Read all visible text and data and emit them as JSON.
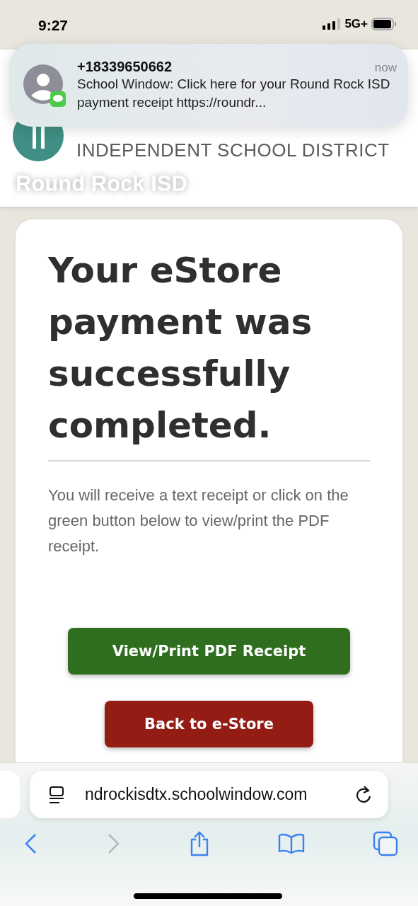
{
  "status_bar": {
    "time": "9:27",
    "network": "5G+"
  },
  "notification": {
    "sender": "+18339650662",
    "time": "now",
    "message": "School Window: Click here for your Round Rock ISD payment receipt https://roundr..."
  },
  "header": {
    "district_line": "INDEPENDENT SCHOOL DISTRICT",
    "site_title": "Round Rock ISD"
  },
  "card": {
    "heading": "Your eStore payment was successfully completed.",
    "message": "You will receive a text receipt or click on the green button below to view/print the PDF receipt.",
    "buttons": [
      {
        "label": "View/Print PDF Receipt",
        "kind": "primary"
      },
      {
        "label": "Back to e-Store",
        "kind": "danger"
      }
    ]
  },
  "browser": {
    "url": "ndrockisdtx.schoolwindow.com",
    "back_disabled": false,
    "forward_disabled": true
  }
}
